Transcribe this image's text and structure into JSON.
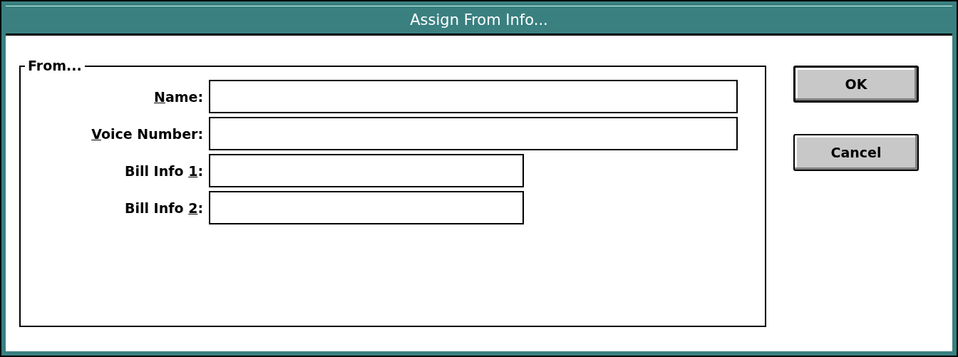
{
  "window": {
    "title": "Assign From Info..."
  },
  "group": {
    "title": "From...",
    "fields": [
      {
        "access_key": "N",
        "label_after": "ame:",
        "kind": "wide"
      },
      {
        "access_key": "V",
        "label_after": "oice Number:",
        "kind": "wide"
      },
      {
        "label_before": "Bill Info ",
        "access_key": "1",
        "label_after": ":",
        "kind": "narrow"
      },
      {
        "label_before": "Bill Info ",
        "access_key": "2",
        "label_after": ":",
        "kind": "narrow"
      }
    ]
  },
  "buttons": [
    {
      "label": "OK",
      "default": true
    },
    {
      "label": "Cancel",
      "default": false
    }
  ]
}
